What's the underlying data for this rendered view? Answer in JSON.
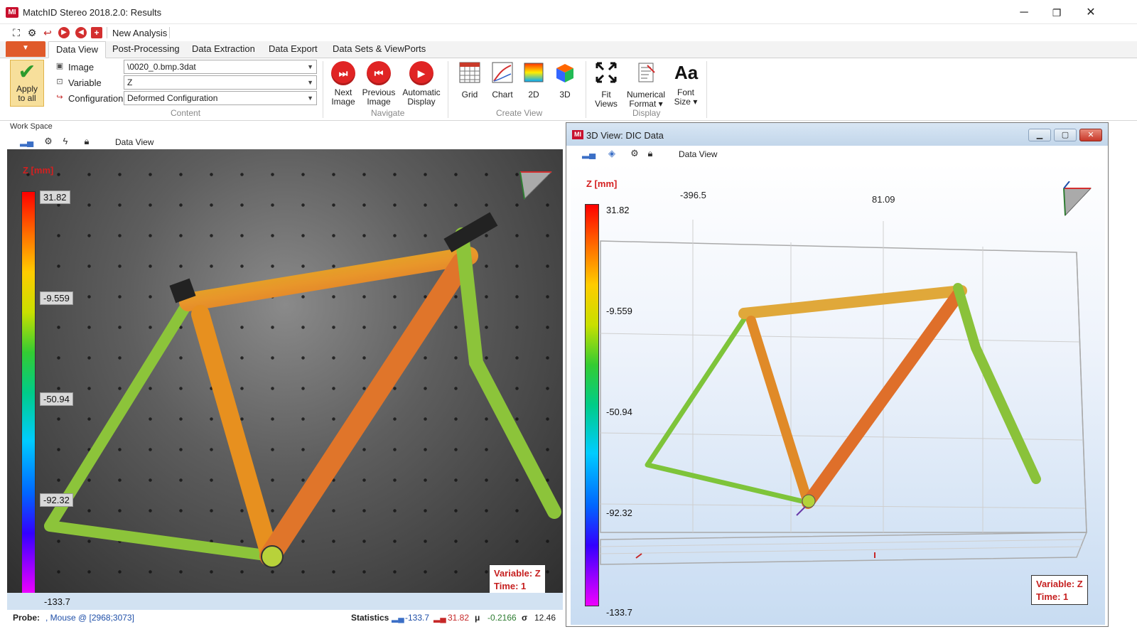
{
  "window": {
    "title": "MatchID Stereo 2018.2.0: Results",
    "logo_text": "MI",
    "minimize": "─",
    "restore": "❐",
    "close": "✕"
  },
  "quickbar": {
    "new_analysis": "New Analysis"
  },
  "ribbon_tabs": [
    "Data View",
    "Post-Processing",
    "Data Extraction",
    "Data Export",
    "Data Sets & ViewPorts"
  ],
  "ribbon": {
    "apply": {
      "line1": "Apply",
      "line2": "to all"
    },
    "content": {
      "image_label": "Image",
      "image_value": "\\0020_0.bmp.3dat",
      "variable_label": "Variable",
      "variable_value": "Z",
      "configuration_label": "Configuration",
      "configuration_value": "Deformed Configuration",
      "group_label": "Content"
    },
    "navigate": {
      "next_line1": "Next",
      "next_line2": "Image",
      "prev_line1": "Previous",
      "prev_line2": "Image",
      "auto_line1": "Automatic",
      "auto_line2": "Display",
      "group_label": "Navigate"
    },
    "create_view": {
      "grid": "Grid",
      "chart": "Chart",
      "view2d": "2D",
      "view3d": "3D",
      "group_label": "Create View"
    },
    "display": {
      "fit_line1": "Fit",
      "fit_line2": "Views",
      "numfmt_line1": "Numerical",
      "numfmt_line2": "Format ▾",
      "font_line1": "Font",
      "font_line2": "Size ▾",
      "font_glyph": "Aa",
      "group_label": "Display"
    }
  },
  "workspace": {
    "label": "Work Space",
    "left_toolbar_label": "Data View"
  },
  "left_view": {
    "colorbar_title": "Z [mm]",
    "ticks": [
      "31.82",
      "-9.559",
      "-50.94",
      "-92.32",
      "-133.7"
    ],
    "variable_label": "Variable: Z",
    "time_label": "Time: 1"
  },
  "statusbar": {
    "probe_label": "Probe:",
    "probe_value": ", Mouse @ [2968;3073]",
    "statistics_label": "Statistics",
    "min": "-133.7",
    "max": "31.82",
    "mu_symbol": "μ",
    "mean": "-0.2166",
    "sigma_symbol": "σ",
    "std": "12.46"
  },
  "win3d": {
    "title": "3D View: DIC Data",
    "toolbar_label": "Data View",
    "colorbar_title": "Z [mm]",
    "ticks": [
      "31.82",
      "-9.559",
      "-50.94",
      "-92.32",
      "-133.7"
    ],
    "axis_label_1": "-396.5",
    "axis_label_2": "81.09",
    "variable_label": "Variable: Z",
    "time_label": "Time: 1"
  },
  "colors": {
    "accent_red": "#d42020",
    "frame_warm": "#e8882a",
    "frame_green": "#7cc23a"
  }
}
